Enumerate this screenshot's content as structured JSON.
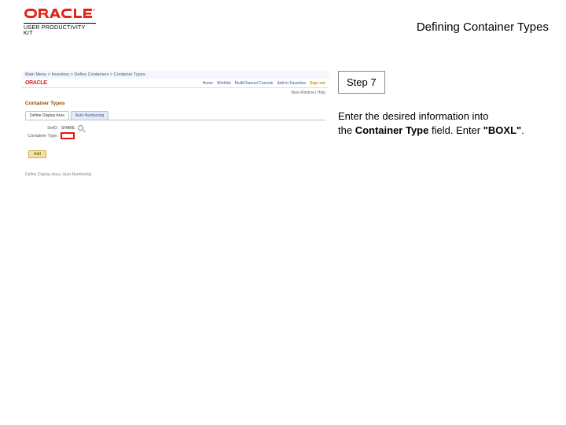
{
  "header": {
    "brand": "ORACLE",
    "subbrand": "USER PRODUCTIVITY KIT",
    "title": "Defining Container Types"
  },
  "instruction": {
    "step_label": "Step 7",
    "line1": "Enter the desired information into",
    "line2_pre": "the ",
    "line2_bold": "Container Type",
    "line2_mid": " field. Enter ",
    "line2_val": "\"BOXL\"",
    "line2_end": "."
  },
  "mini": {
    "breadcrumb": "Main Menu > Inventory > Define Containers > Container Types",
    "brand": "ORACLE",
    "nav": {
      "home": "Home",
      "worklist": "Worklist",
      "mcl": "MultiChannel Console",
      "add": "Add to Favorites",
      "signout": "Sign out"
    },
    "status": "New Window | Help",
    "page_title": "Container Types",
    "tabs": {
      "t1": "Define Display Area",
      "t2": "Auto-Numbering"
    },
    "fields": {
      "setid_label": "SetID:",
      "setid_value": "SHARE",
      "ct_label": "Container Type:"
    },
    "add_btn": "Add",
    "footer": "Define Display Area | Auto-Numbering"
  }
}
